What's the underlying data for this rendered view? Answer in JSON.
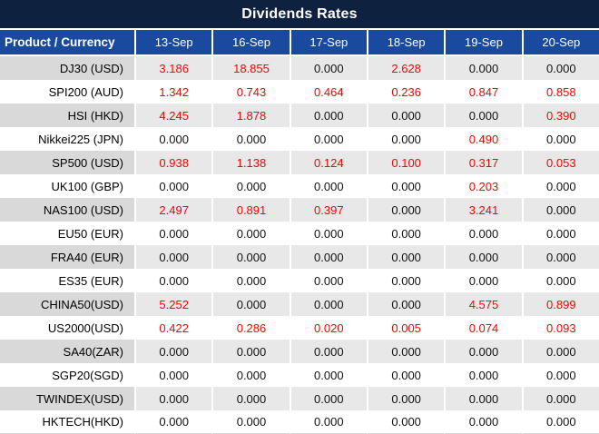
{
  "title": "Dividends Rates",
  "columns": [
    "Product / Currency",
    "13-Sep",
    "16-Sep",
    "17-Sep",
    "18-Sep",
    "19-Sep",
    "20-Sep"
  ],
  "rows": [
    {
      "product": "DJ30 (USD)",
      "values": [
        "3.186",
        "18.855",
        "0.000",
        "2.628",
        "0.000",
        "0.000"
      ],
      "red": [
        true,
        true,
        false,
        true,
        false,
        false
      ]
    },
    {
      "product": "SPI200 (AUD)",
      "values": [
        "1.342",
        "0.743",
        "0.464",
        "0.236",
        "0.847",
        "0.858"
      ],
      "red": [
        true,
        true,
        true,
        true,
        true,
        true
      ]
    },
    {
      "product": "HSI (HKD)",
      "values": [
        "4.245",
        "1.878",
        "0.000",
        "0.000",
        "0.000",
        "0.390"
      ],
      "red": [
        true,
        true,
        false,
        false,
        false,
        true
      ]
    },
    {
      "product": "Nikkei225 (JPN)",
      "values": [
        "0.000",
        "0.000",
        "0.000",
        "0.000",
        "0.490",
        "0.000"
      ],
      "red": [
        false,
        false,
        false,
        false,
        true,
        false
      ]
    },
    {
      "product": "SP500 (USD)",
      "values": [
        "0.938",
        "1.138",
        "0.124",
        "0.100",
        "0.317",
        "0.053"
      ],
      "red": [
        true,
        true,
        true,
        true,
        true,
        true
      ]
    },
    {
      "product": "UK100 (GBP)",
      "values": [
        "0.000",
        "0.000",
        "0.000",
        "0.000",
        "0.203",
        "0.000"
      ],
      "red": [
        false,
        false,
        false,
        false,
        true,
        false
      ]
    },
    {
      "product": "NAS100 (USD)",
      "values": [
        "2.497",
        "0.891",
        "0.397",
        "0.000",
        "3.241",
        "0.000"
      ],
      "red": [
        true,
        true,
        true,
        false,
        true,
        false
      ]
    },
    {
      "product": "EU50 (EUR)",
      "values": [
        "0.000",
        "0.000",
        "0.000",
        "0.000",
        "0.000",
        "0.000"
      ],
      "red": [
        false,
        false,
        false,
        false,
        false,
        false
      ]
    },
    {
      "product": "FRA40 (EUR)",
      "values": [
        "0.000",
        "0.000",
        "0.000",
        "0.000",
        "0.000",
        "0.000"
      ],
      "red": [
        false,
        false,
        false,
        false,
        false,
        false
      ]
    },
    {
      "product": "ES35 (EUR)",
      "values": [
        "0.000",
        "0.000",
        "0.000",
        "0.000",
        "0.000",
        "0.000"
      ],
      "red": [
        false,
        false,
        false,
        false,
        false,
        false
      ]
    },
    {
      "product": "CHINA50(USD)",
      "values": [
        "5.252",
        "0.000",
        "0.000",
        "0.000",
        "4.575",
        "0.899"
      ],
      "red": [
        true,
        false,
        false,
        false,
        true,
        true
      ]
    },
    {
      "product": "US2000(USD)",
      "values": [
        "0.422",
        "0.286",
        "0.020",
        "0.005",
        "0.074",
        "0.093"
      ],
      "red": [
        true,
        true,
        true,
        true,
        true,
        true
      ]
    },
    {
      "product": "SA40(ZAR)",
      "values": [
        "0.000",
        "0.000",
        "0.000",
        "0.000",
        "0.000",
        "0.000"
      ],
      "red": [
        false,
        false,
        false,
        false,
        false,
        false
      ]
    },
    {
      "product": "SGP20(SGD)",
      "values": [
        "0.000",
        "0.000",
        "0.000",
        "0.000",
        "0.000",
        "0.000"
      ],
      "red": [
        false,
        false,
        false,
        false,
        false,
        false
      ]
    },
    {
      "product": "TWINDEX(USD)",
      "values": [
        "0.000",
        "0.000",
        "0.000",
        "0.000",
        "0.000",
        "0.000"
      ],
      "red": [
        false,
        false,
        false,
        false,
        false,
        false
      ]
    },
    {
      "product": "HKTECH(HKD)",
      "values": [
        "0.000",
        "0.000",
        "0.000",
        "0.000",
        "0.000",
        "0.000"
      ],
      "red": [
        false,
        false,
        false,
        false,
        false,
        false
      ]
    }
  ],
  "colors": {
    "title_bar_bg": "#0e2240",
    "header_bg": "#1a4a9e",
    "alt_row_product_bg": "#d9d9d9",
    "alt_row_data_bg": "#e8e8e8",
    "white_row_bg": "#ffffff",
    "highlight_value_color": "#ff0000",
    "normal_value_color": "#111111",
    "header_text_color": "#ffffff"
  }
}
